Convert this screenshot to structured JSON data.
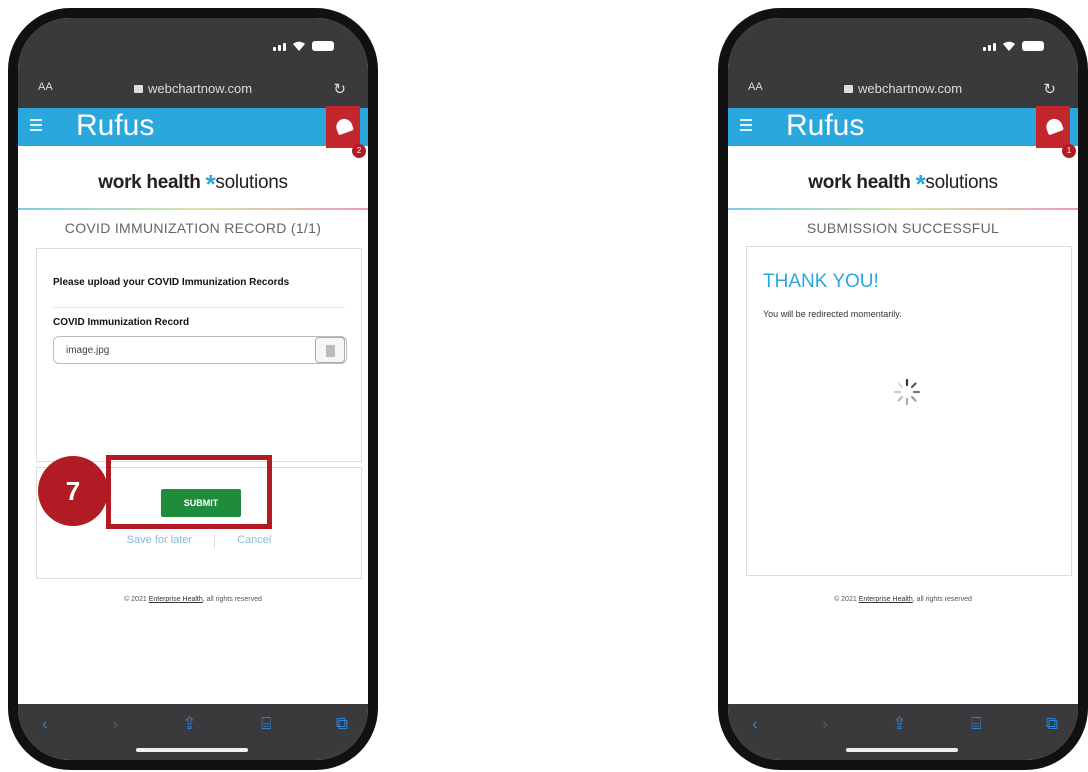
{
  "browser": {
    "aa_label": "AA",
    "url": "webchartnow.com"
  },
  "app": {
    "title": "Rufus",
    "logo_bold": "work health",
    "logo_star": "*",
    "logo_rest": "solutions"
  },
  "left_phone": {
    "notification_count": "2",
    "section_title": "COVID IMMUNIZATION RECORD (1/1)",
    "prompt": "Please upload your COVID Immunization Records",
    "field_label": "COVID Immunization Record",
    "file_value": "image.jpg",
    "submit_label": "SUBMIT",
    "save_label": "Save for later",
    "cancel_label": "Cancel",
    "callout_number": "7"
  },
  "right_phone": {
    "notification_count": "1",
    "section_title": "SUBMISSION SUCCESSFUL",
    "thanks": "THANK YOU!",
    "redirect_text": "You will be redirected momentarily."
  },
  "footer": {
    "prefix": "© 2021 ",
    "link": "Enterprise Health",
    "suffix": ", all rights reserved"
  },
  "colors": {
    "accent": "#2aa7dc",
    "alert": "#c4262e",
    "submit": "#1e8c3a",
    "callout": "#b11c24"
  },
  "icons": {
    "toolbar": [
      "back-icon",
      "forward-icon",
      "share-icon",
      "bookmarks-icon",
      "tabs-icon"
    ]
  }
}
